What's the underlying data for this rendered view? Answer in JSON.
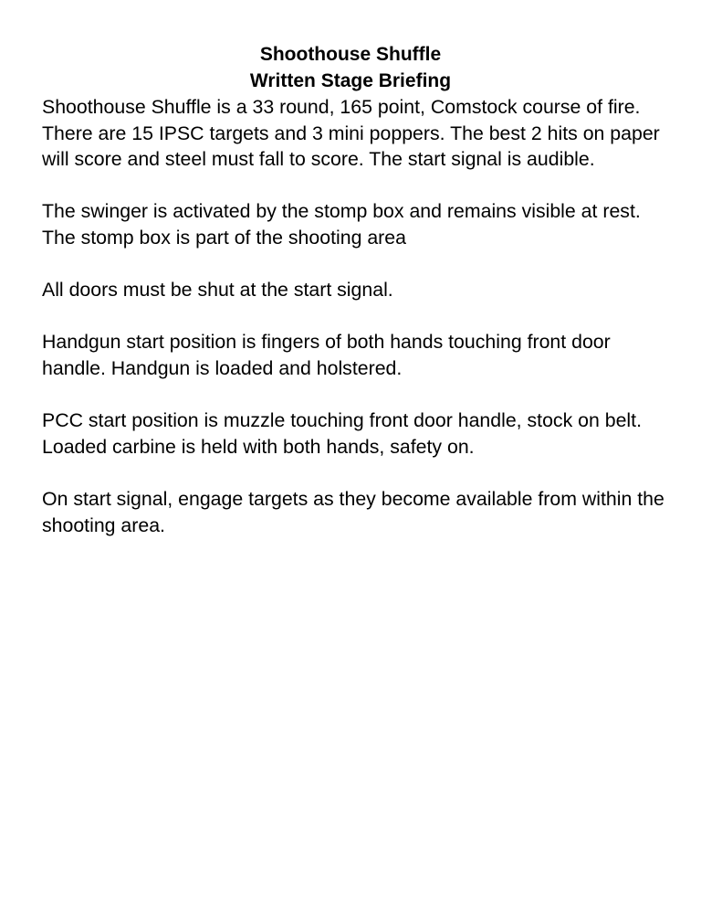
{
  "document": {
    "title": "Shoothouse Shuffle",
    "subtitle": "Written Stage Briefing",
    "paragraphs": [
      "Shoothouse Shuffle is a 33 round, 165 point, Comstock course of fire. There are 15 IPSC targets and 3 mini poppers. The best 2 hits on paper will score and steel must fall to score. The start signal is audible.",
      "The swinger is activated by the stomp box and remains visible at rest. The stomp box is part of the shooting area",
      "All doors must be shut at the start signal.",
      "Handgun start position is fingers of both hands touching front door handle. Handgun is loaded and holstered.",
      "PCC start position is muzzle touching front door handle, stock on belt. Loaded carbine is held with both hands, safety on.",
      "On start signal, engage targets as they become available from within the shooting area."
    ]
  }
}
